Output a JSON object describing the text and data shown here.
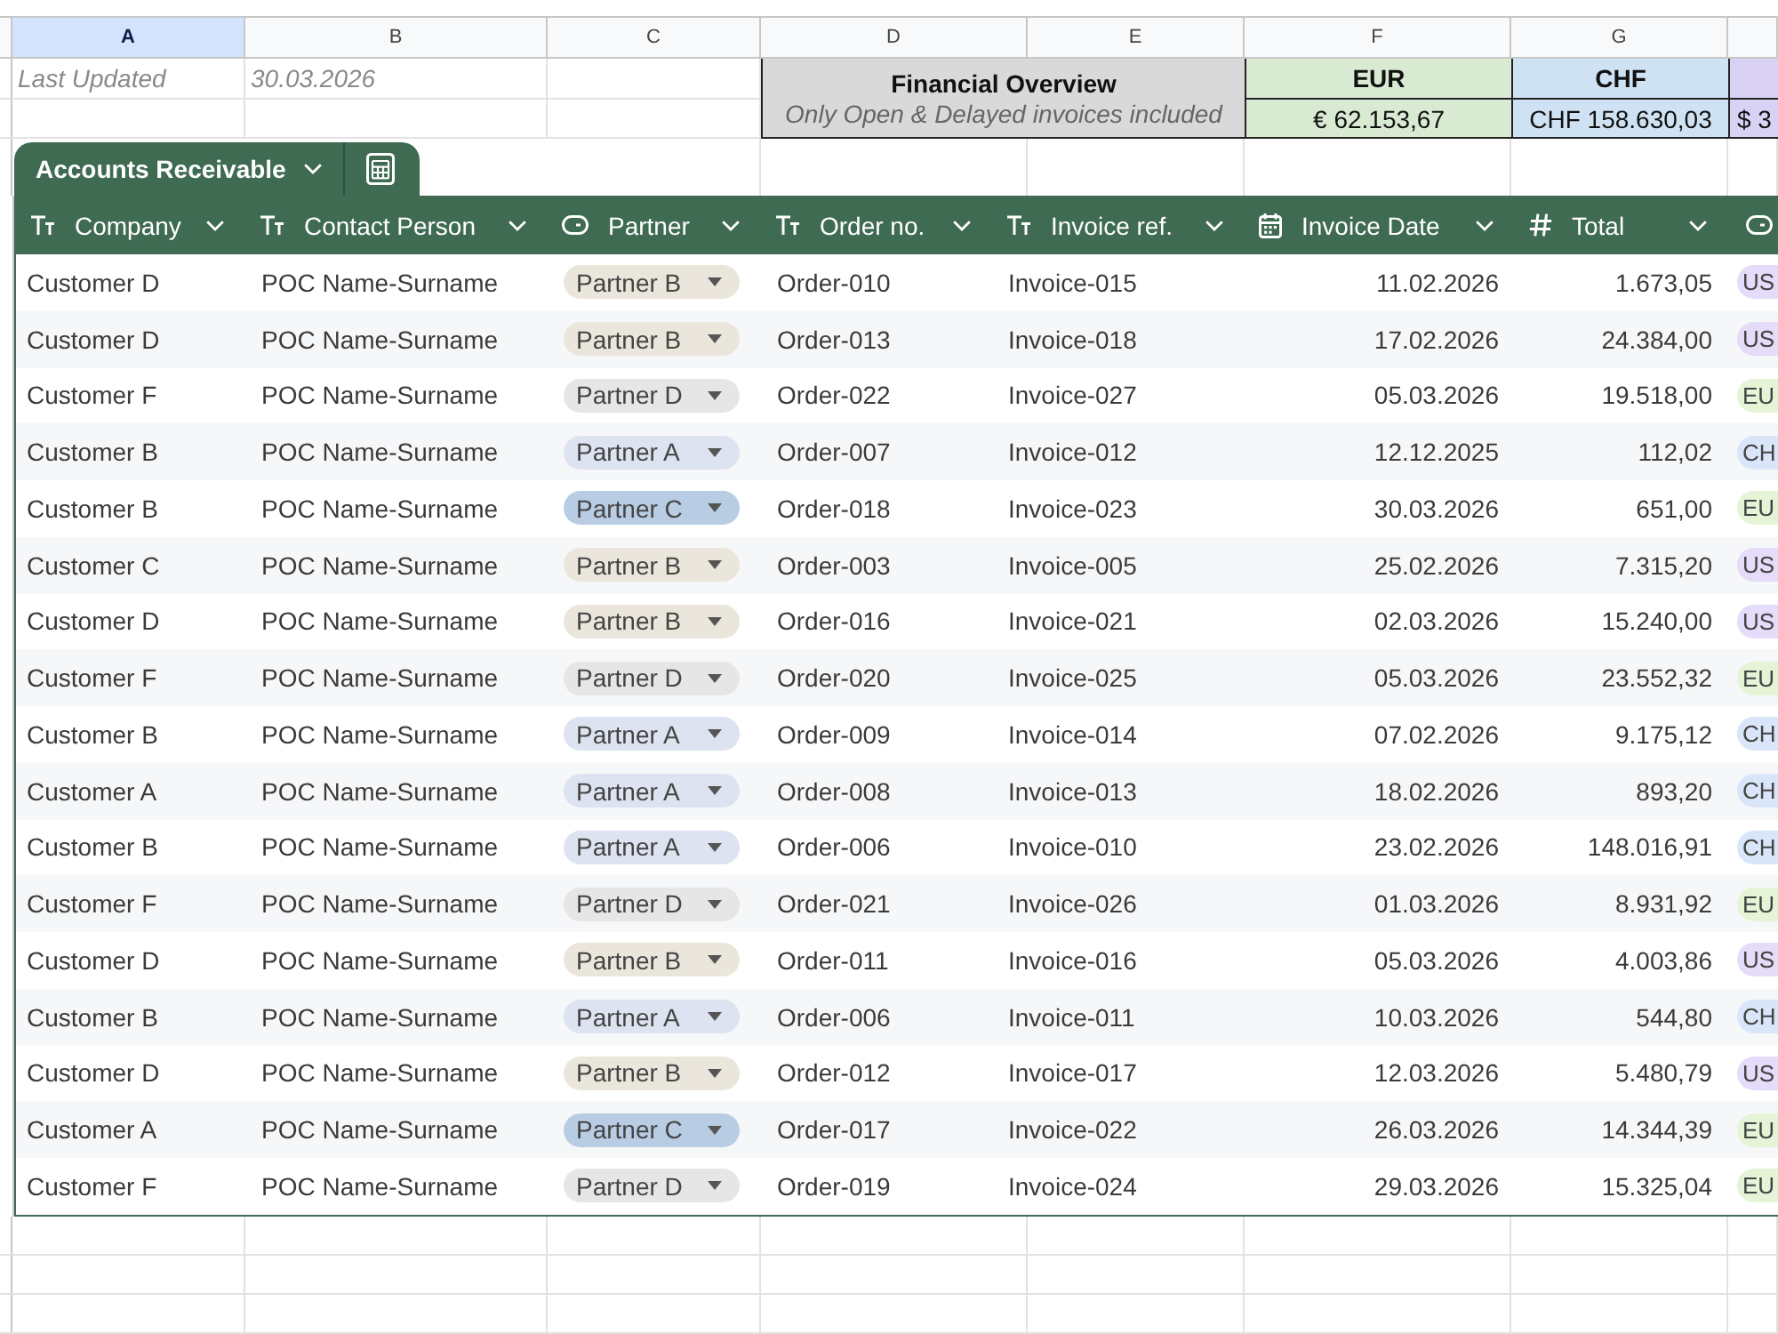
{
  "sheet": {
    "column_headers": [
      {
        "letter": "A",
        "selected": true
      },
      {
        "letter": "B",
        "selected": false
      },
      {
        "letter": "C",
        "selected": false
      },
      {
        "letter": "D",
        "selected": false
      },
      {
        "letter": "E",
        "selected": false
      },
      {
        "letter": "F",
        "selected": false
      },
      {
        "letter": "G",
        "selected": false
      }
    ],
    "last_updated": {
      "label": "Last Updated",
      "value": "30.03.2026"
    },
    "overview": {
      "title": "Financial Overview",
      "note": "Only Open & Delayed invoices included"
    },
    "totals": [
      {
        "currency": "EUR",
        "amount": "€ 62.153,67",
        "color": "#d9ead3"
      },
      {
        "currency": "CHF",
        "amount": "CHF 158.630,03",
        "color": "#cfe2f3"
      },
      {
        "amount": "$ 3",
        "color": "#d9d2f5"
      }
    ]
  },
  "table": {
    "name": "Accounts Receivable",
    "columns": [
      {
        "label": "Company",
        "kind": "text"
      },
      {
        "label": "Contact Person",
        "kind": "text"
      },
      {
        "label": "Partner",
        "kind": "select"
      },
      {
        "label": "Order no.",
        "kind": "text"
      },
      {
        "label": "Invoice ref.",
        "kind": "text"
      },
      {
        "label": "Invoice Date",
        "kind": "date"
      },
      {
        "label": "Total",
        "kind": "number"
      },
      {
        "kind": "select"
      }
    ],
    "rows": [
      {
        "company": "Customer D",
        "contact": "POC Name-Surname",
        "partner": {
          "label": "Partner B",
          "color": "#ebe6dc"
        },
        "order": "Order-010",
        "invoice": "Invoice-015",
        "date": "11.02.2026",
        "total": "1.673,05",
        "currency": {
          "label": "US",
          "color": "#e4dcf8"
        }
      },
      {
        "company": "Customer D",
        "contact": "POC Name-Surname",
        "partner": {
          "label": "Partner B",
          "color": "#ebe6dc"
        },
        "order": "Order-013",
        "invoice": "Invoice-018",
        "date": "17.02.2026",
        "total": "24.384,00",
        "currency": {
          "label": "US",
          "color": "#e4dcf8"
        }
      },
      {
        "company": "Customer F",
        "contact": "POC Name-Surname",
        "partner": {
          "label": "Partner D",
          "color": "#e6e6e6"
        },
        "order": "Order-022",
        "invoice": "Invoice-027",
        "date": "05.03.2026",
        "total": "19.518,00",
        "currency": {
          "label": "EU",
          "color": "#e5f4d6"
        }
      },
      {
        "company": "Customer B",
        "contact": "POC Name-Surname",
        "partner": {
          "label": "Partner A",
          "color": "#dde3f0"
        },
        "order": "Order-007",
        "invoice": "Invoice-012",
        "date": "12.12.2025",
        "total": "112,02",
        "currency": {
          "label": "CH",
          "color": "#d9e6fa"
        }
      },
      {
        "company": "Customer B",
        "contact": "POC Name-Surname",
        "partner": {
          "label": "Partner C",
          "color": "#b8cce4"
        },
        "order": "Order-018",
        "invoice": "Invoice-023",
        "date": "30.03.2026",
        "total": "651,00",
        "currency": {
          "label": "EU",
          "color": "#e5f4d6"
        }
      },
      {
        "company": "Customer C",
        "contact": "POC Name-Surname",
        "partner": {
          "label": "Partner B",
          "color": "#ebe6dc"
        },
        "order": "Order-003",
        "invoice": "Invoice-005",
        "date": "25.02.2026",
        "total": "7.315,20",
        "currency": {
          "label": "US",
          "color": "#e4dcf8"
        }
      },
      {
        "company": "Customer D",
        "contact": "POC Name-Surname",
        "partner": {
          "label": "Partner B",
          "color": "#ebe6dc"
        },
        "order": "Order-016",
        "invoice": "Invoice-021",
        "date": "02.03.2026",
        "total": "15.240,00",
        "currency": {
          "label": "US",
          "color": "#e4dcf8"
        }
      },
      {
        "company": "Customer F",
        "contact": "POC Name-Surname",
        "partner": {
          "label": "Partner D",
          "color": "#e6e6e6"
        },
        "order": "Order-020",
        "invoice": "Invoice-025",
        "date": "05.03.2026",
        "total": "23.552,32",
        "currency": {
          "label": "EU",
          "color": "#e5f4d6"
        }
      },
      {
        "company": "Customer B",
        "contact": "POC Name-Surname",
        "partner": {
          "label": "Partner A",
          "color": "#dde3f0"
        },
        "order": "Order-009",
        "invoice": "Invoice-014",
        "date": "07.02.2026",
        "total": "9.175,12",
        "currency": {
          "label": "CH",
          "color": "#d9e6fa"
        }
      },
      {
        "company": "Customer A",
        "contact": "POC Name-Surname",
        "partner": {
          "label": "Partner A",
          "color": "#dde3f0"
        },
        "order": "Order-008",
        "invoice": "Invoice-013",
        "date": "18.02.2026",
        "total": "893,20",
        "currency": {
          "label": "CH",
          "color": "#d9e6fa"
        }
      },
      {
        "company": "Customer B",
        "contact": "POC Name-Surname",
        "partner": {
          "label": "Partner A",
          "color": "#dde3f0"
        },
        "order": "Order-006",
        "invoice": "Invoice-010",
        "date": "23.02.2026",
        "total": "148.016,91",
        "currency": {
          "label": "CH",
          "color": "#d9e6fa"
        }
      },
      {
        "company": "Customer F",
        "contact": "POC Name-Surname",
        "partner": {
          "label": "Partner D",
          "color": "#e6e6e6"
        },
        "order": "Order-021",
        "invoice": "Invoice-026",
        "date": "01.03.2026",
        "total": "8.931,92",
        "currency": {
          "label": "EU",
          "color": "#e5f4d6"
        }
      },
      {
        "company": "Customer D",
        "contact": "POC Name-Surname",
        "partner": {
          "label": "Partner B",
          "color": "#ebe6dc"
        },
        "order": "Order-011",
        "invoice": "Invoice-016",
        "date": "05.03.2026",
        "total": "4.003,86",
        "currency": {
          "label": "US",
          "color": "#e4dcf8"
        }
      },
      {
        "company": "Customer B",
        "contact": "POC Name-Surname",
        "partner": {
          "label": "Partner A",
          "color": "#dde3f0"
        },
        "order": "Order-006",
        "invoice": "Invoice-011",
        "date": "10.03.2026",
        "total": "544,80",
        "currency": {
          "label": "CH",
          "color": "#d9e6fa"
        }
      },
      {
        "company": "Customer D",
        "contact": "POC Name-Surname",
        "partner": {
          "label": "Partner B",
          "color": "#ebe6dc"
        },
        "order": "Order-012",
        "invoice": "Invoice-017",
        "date": "12.03.2026",
        "total": "5.480,79",
        "currency": {
          "label": "US",
          "color": "#e4dcf8"
        }
      },
      {
        "company": "Customer A",
        "contact": "POC Name-Surname",
        "partner": {
          "label": "Partner C",
          "color": "#b8cce4"
        },
        "order": "Order-017",
        "invoice": "Invoice-022",
        "date": "26.03.2026",
        "total": "14.344,39",
        "currency": {
          "label": "EU",
          "color": "#e5f4d6"
        }
      },
      {
        "company": "Customer F",
        "contact": "POC Name-Surname",
        "partner": {
          "label": "Partner D",
          "color": "#e6e6e6"
        },
        "order": "Order-019",
        "invoice": "Invoice-024",
        "date": "29.03.2026",
        "total": "15.325,04",
        "currency": {
          "label": "EU",
          "color": "#e5f4d6"
        }
      }
    ]
  }
}
